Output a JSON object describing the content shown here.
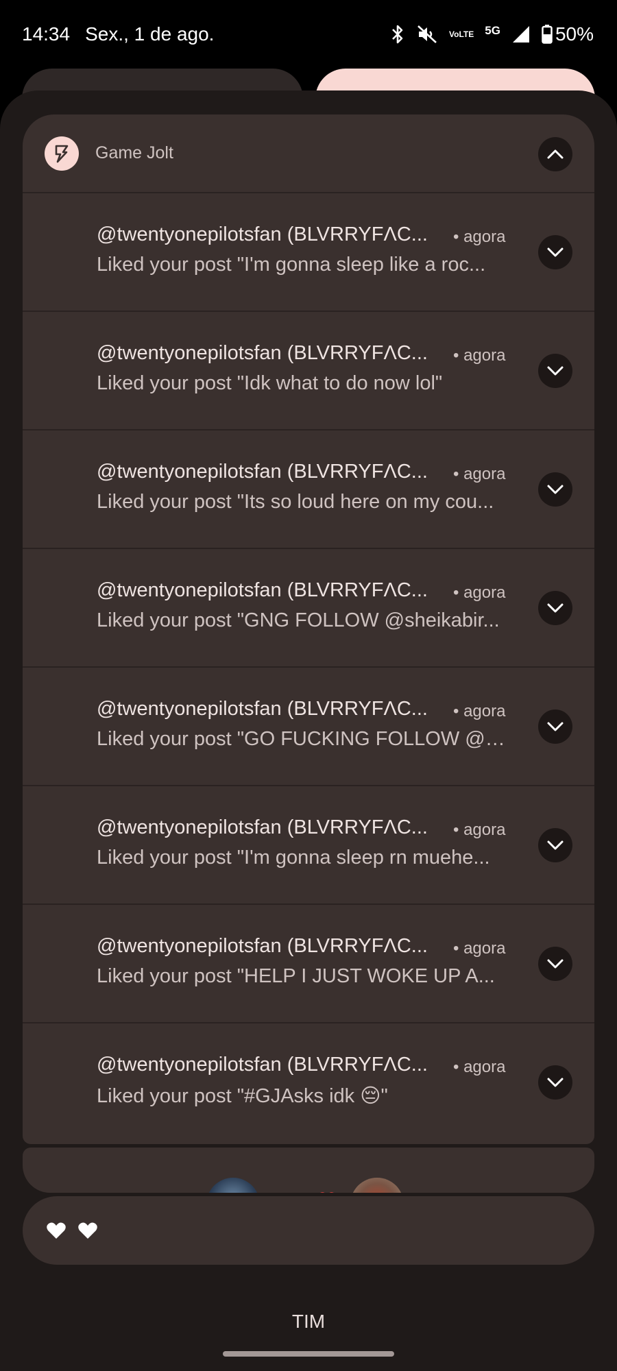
{
  "status_bar": {
    "time": "14:34",
    "date": "Sex., 1 de ago.",
    "volte_line1": "Vo",
    "volte_line2": "LTE",
    "network": "5G",
    "battery": "50%",
    "icons": [
      "bluetooth-icon",
      "mute-icon",
      "volte-icon",
      "signal-icon",
      "battery-icon"
    ]
  },
  "group": {
    "app_name": "Game Jolt",
    "app_icon": "game-jolt-icon",
    "notifications": [
      {
        "title": "@twentyonepilotsfan (BLVRRYFΛC...",
        "time": "• agora",
        "body": "Liked your post \"I'm gonna sleep like a roc..."
      },
      {
        "title": "@twentyonepilotsfan (BLVRRYFΛC...",
        "time": "• agora",
        "body": "Liked your post \"Idk what to do now lol\""
      },
      {
        "title": "@twentyonepilotsfan (BLVRRYFΛC...",
        "time": "• agora",
        "body": "Liked your post \"Its so loud here on my cou..."
      },
      {
        "title": "@twentyonepilotsfan (BLVRRYFΛC...",
        "time": "• agora",
        "body": "Liked your post \"GNG FOLLOW @sheikabir..."
      },
      {
        "title": "@twentyonepilotsfan (BLVRRYFΛC...",
        "time": "• agora",
        "body": "Liked your post \"GO FUCKING FOLLOW @A..."
      },
      {
        "title": "@twentyonepilotsfan (BLVRRYFΛC...",
        "time": "• agora",
        "body": "Liked your post \"I'm gonna sleep rn muehe..."
      },
      {
        "title": "@twentyonepilotsfan (BLVRRYFΛC...",
        "time": "• agora",
        "body": "Liked your post \"HELP I JUST WOKE UP A..."
      },
      {
        "title": "@twentyonepilotsfan (BLVRRYFΛC...",
        "time": "• agora",
        "body": "Liked your post \"#GJAsks idk 😔\""
      }
    ]
  },
  "media_card": {
    "text": "❤ ❤"
  },
  "carrier": "TIM",
  "colors": {
    "shade_bg": "#1f1a19",
    "card_bg": "#3a302e",
    "accent": "#f9d8d3",
    "button_bg": "#1d1716"
  }
}
